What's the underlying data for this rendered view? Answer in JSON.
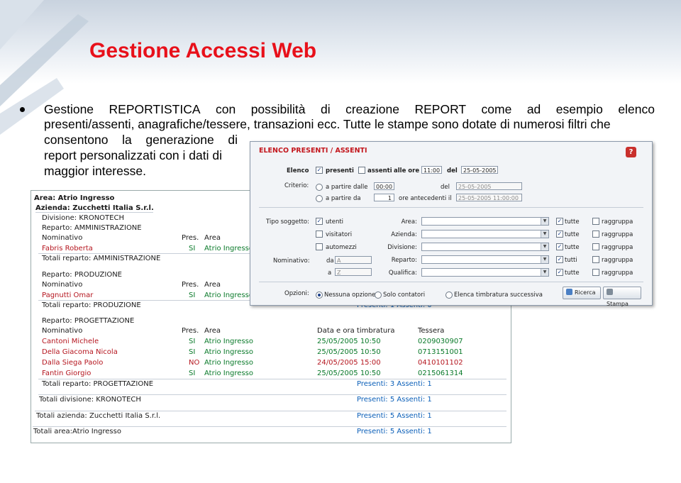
{
  "slide": {
    "title": "Gestione Accessi Web",
    "bullet": {
      "line1_words": [
        "Gestione",
        "REPORTISTICA",
        "con",
        "possibilità",
        "di",
        "creazione",
        "REPORT",
        "come",
        "ad",
        "esempio",
        "elenco"
      ],
      "line2": "presenti/assenti, anagrafiche/tessere, transazioni ecc. Tutte le stampe sono dotate di numerosi filtri che",
      "line3_words": [
        "consentono",
        "la",
        "generazione",
        "di"
      ],
      "line4": "report personalizzati con i dati di",
      "line5": "maggior interesse."
    }
  },
  "report": {
    "area": "Area: Atrio Ingresso",
    "azienda": "Azienda: Zucchetti Italia S.r.l.",
    "divisione": "Divisione: KRONOTECH",
    "col_nominativo": "Nominativo",
    "col_pres": "Pres.",
    "col_area": "Area",
    "col_data": "Data e ora timbratura",
    "col_tessera": "Tessera",
    "reparto1": {
      "name": "Reparto: AMMINISTRAZIONE",
      "row": {
        "nome": "Fabris Roberta",
        "pres": "SI",
        "area": "Atrio Ingresso"
      },
      "total": "Totali reparto: AMMINISTRAZIONE"
    },
    "reparto2": {
      "name": "Reparto: PRODUZIONE",
      "row": {
        "nome": "Pagnutti Omar",
        "pres": "SI",
        "area": "Atrio Ingresso"
      },
      "total": "Totali reparto: PRODUZIONE",
      "presenti": "Presenti: 1 Assenti: 0"
    },
    "reparto3": {
      "name": "Reparto: PROGETTAZIONE",
      "rows": [
        {
          "nome": "Cantoni Michele",
          "pres": "SI",
          "area": "Atrio Ingresso",
          "data": "25/05/2005 10:50",
          "tessera": "0209030907"
        },
        {
          "nome": "Della Giacoma Nicola",
          "pres": "SI",
          "area": "Atrio Ingresso",
          "data": "25/05/2005 10:50",
          "tessera": "0713151001"
        },
        {
          "nome": "Dalla Siega Paolo",
          "pres": "NO",
          "area": "Atrio Ingresso",
          "data": "24/05/2005 15:00",
          "tessera": "0410101102"
        },
        {
          "nome": "Fantin Giorgio",
          "pres": "SI",
          "area": "Atrio Ingresso",
          "data": "25/05/2005 10:50",
          "tessera": "0215061314"
        }
      ],
      "total": "Totali reparto: PROGETTAZIONE",
      "presenti": "Presenti: 3 Assenti: 1"
    },
    "tot_divisione": "Totali divisione: KRONOTECH",
    "tot_divisione_presenti": "Presenti: 5 Assenti: 1",
    "tot_azienda": "Totali azienda: Zucchetti Italia S.r.l.",
    "tot_azienda_presenti": "Presenti: 5 Assenti: 1",
    "tot_area": "Totali area:Atrio Ingresso",
    "tot_area_presenti": "Presenti: 5 Assenti: 1"
  },
  "dialog": {
    "title": "ELENCO PRESENTI / ASSENTI",
    "help": "?",
    "elenco_label": "Elenco",
    "presenti": "presenti",
    "assenti": "assenti",
    "alle_ore": "alle ore",
    "alle_ore_value": "11:00",
    "del": "del",
    "del_value": "25-05-2005",
    "criterio_label": "Criterio:",
    "a_partire_dalle": "a partire dalle",
    "a_partire_dalle_value": "00:00",
    "del2_value": "25-05-2005",
    "a_partire_da": "a partire da",
    "a_partire_da_value": "1",
    "ore_antecedenti": "ore antecedenti il",
    "ore_antecedenti_value": "25-05-2005 11:00:00",
    "tipo_soggetto_label": "Tipo soggetto:",
    "utenti": "utenti",
    "visitatori": "visitatori",
    "automezzi": "automezzi",
    "nominativo_label": "Nominativo:",
    "da": "da",
    "da_value": "A",
    "a": "a",
    "a_value": "Z",
    "area_label": "Area:",
    "azienda_label": "Azienda:",
    "divisione_label": "Divisione:",
    "reparto_label": "Reparto:",
    "qualifica_label": "Qualifica:",
    "tutte": "tutte",
    "tutti": "tutti",
    "raggruppa": "raggruppa",
    "opzioni_label": "Opzioni:",
    "opt1": "Nessuna opzione",
    "opt2": "Solo contatori",
    "opt3": "Elenca timbratura successiva",
    "ricerca": "Ricerca",
    "stampa": "Stampa"
  },
  "colors": {
    "title_red": "#e8101a",
    "dialog_title": "#c3161c",
    "report_blue": "#0b5fb8"
  }
}
